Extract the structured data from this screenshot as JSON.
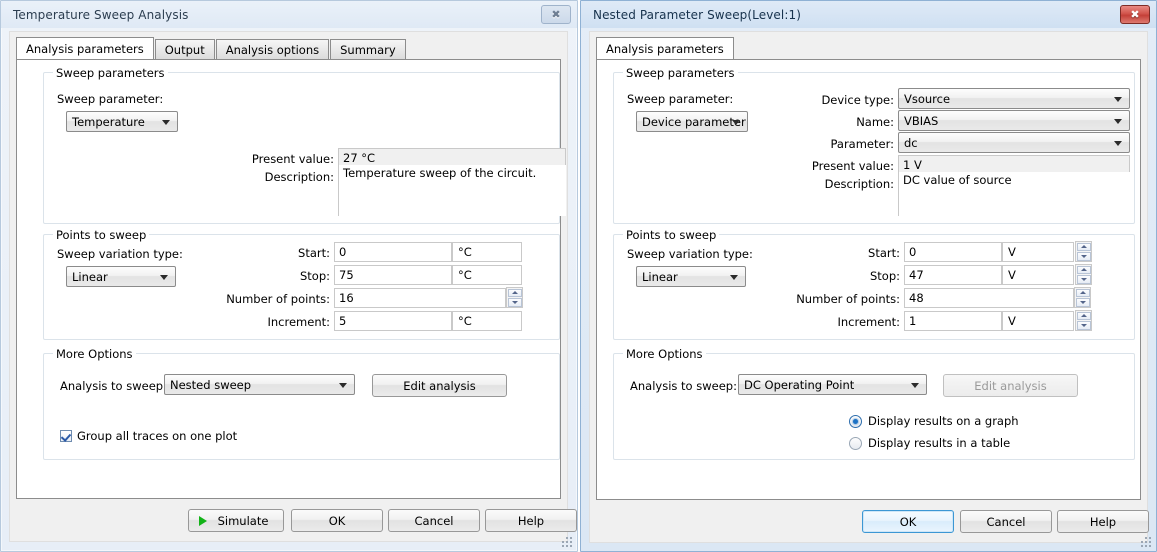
{
  "left_window": {
    "title": "Temperature Sweep Analysis",
    "close_label": "✖",
    "tabs": [
      {
        "label": "Analysis parameters",
        "active": true
      },
      {
        "label": "Output",
        "active": false
      },
      {
        "label": "Analysis options",
        "active": false
      },
      {
        "label": "Summary",
        "active": false
      }
    ],
    "sweep_parameters": {
      "group_title": "Sweep parameters",
      "sweep_parameter_label": "Sweep parameter:",
      "sweep_parameter_value": "Temperature",
      "present_value_label": "Present value:",
      "present_value": "27 °C",
      "description_label": "Description:",
      "description": "Temperature sweep of the circuit."
    },
    "points_to_sweep": {
      "group_title": "Points to sweep",
      "variation_label": "Sweep variation type:",
      "variation_value": "Linear",
      "start_label": "Start:",
      "start_value": "0",
      "start_unit": "°C",
      "stop_label": "Stop:",
      "stop_value": "75",
      "stop_unit": "°C",
      "points_label": "Number of points:",
      "points_value": "16",
      "increment_label": "Increment:",
      "increment_value": "5",
      "increment_unit": "°C"
    },
    "more_options": {
      "group_title": "More Options",
      "analysis_label": "Analysis to sweep:",
      "analysis_value": "Nested sweep",
      "edit_button": "Edit analysis",
      "group_traces_label": "Group all traces on one plot",
      "group_traces_checked": true
    },
    "buttons": {
      "simulate": "Simulate",
      "ok": "OK",
      "cancel": "Cancel",
      "help": "Help"
    }
  },
  "right_window": {
    "title": "Nested Parameter Sweep(Level:1)",
    "close_label": "✖",
    "tabs": [
      {
        "label": "Analysis parameters",
        "active": true
      }
    ],
    "sweep_parameters": {
      "group_title": "Sweep parameters",
      "sweep_parameter_label": "Sweep parameter:",
      "sweep_parameter_value": "Device parameter",
      "device_type_label": "Device type:",
      "device_type_value": "Vsource",
      "name_label": "Name:",
      "name_value": "VBIAS",
      "parameter_label": "Parameter:",
      "parameter_value": "dc",
      "present_value_label": "Present value:",
      "present_value": "1 V",
      "description_label": "Description:",
      "description": "DC value of source"
    },
    "points_to_sweep": {
      "group_title": "Points to sweep",
      "variation_label": "Sweep variation type:",
      "variation_value": "Linear",
      "start_label": "Start:",
      "start_value": "0",
      "start_unit": "V",
      "stop_label": "Stop:",
      "stop_value": "47",
      "stop_unit": "V",
      "points_label": "Number of points:",
      "points_value": "48",
      "increment_label": "Increment:",
      "increment_value": "1",
      "increment_unit": "V"
    },
    "more_options": {
      "group_title": "More Options",
      "analysis_label": "Analysis to sweep:",
      "analysis_value": "DC Operating Point",
      "edit_button": "Edit analysis",
      "radio_graph_label": "Display results on a graph",
      "radio_table_label": "Display results in a table",
      "radio_selected": "graph"
    },
    "buttons": {
      "ok": "OK",
      "cancel": "Cancel",
      "help": "Help"
    }
  }
}
